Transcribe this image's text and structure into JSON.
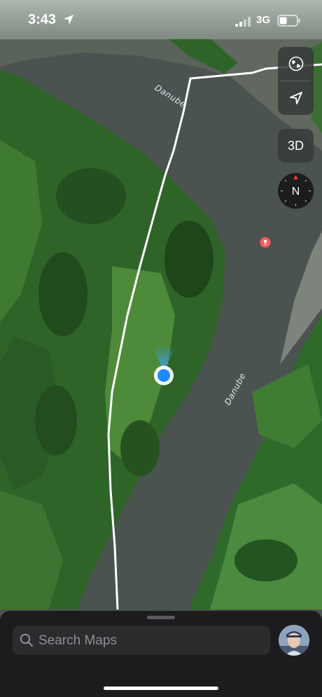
{
  "status_bar": {
    "time": "3:43",
    "network": "3G",
    "icons": [
      "location-arrow-icon",
      "cellular-signal-icon",
      "battery-icon"
    ]
  },
  "map": {
    "labels": {
      "river_top": "Danube",
      "river_bottom": "Danube"
    },
    "colors": {
      "water": "#4b5450",
      "forest": "#2f6b2a",
      "meadow": "#4e8f3c",
      "route": "#ffffff",
      "user_location": "#1a8cff",
      "pin": "#ff5a5f"
    }
  },
  "controls": {
    "map_mode_icon": "globe-icon",
    "tracking_icon": "location-arrow-icon",
    "view_3d_label": "3D",
    "compass_label": "N"
  },
  "search": {
    "placeholder": "Search Maps",
    "icon": "magnifier-icon"
  },
  "account": {
    "icon": "avatar-icon"
  }
}
